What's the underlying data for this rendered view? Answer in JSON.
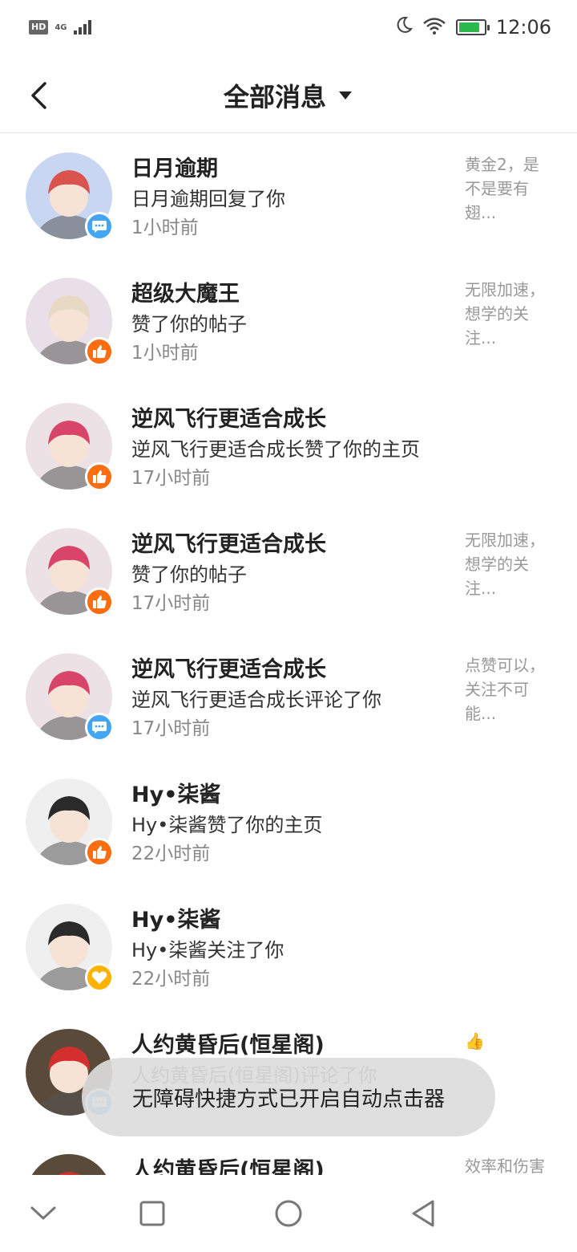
{
  "status_bar": {
    "hd": "HD",
    "network": "4G",
    "time": "12:06",
    "battery_level": 0.85
  },
  "header": {
    "title": "全部消息"
  },
  "messages": [
    {
      "name": "日月逾期",
      "action": "日月逾期回复了你",
      "time": "1小时前",
      "preview": "黄金2，是不是要有翅...",
      "badge": "comment",
      "avatar_color": "#c9d6f2",
      "hair": "#d9534f"
    },
    {
      "name": "超级大魔王",
      "action": "赞了你的帖子",
      "time": "1小时前",
      "preview": "无限加速，想学的关注...",
      "badge": "like",
      "avatar_color": "#e9dfe8",
      "hair": "#e8d9c4"
    },
    {
      "name": "逆风飞行更适合成长",
      "action": "逆风飞行更适合成长赞了你的主页",
      "time": "17小时前",
      "preview": "",
      "badge": "like",
      "avatar_color": "#ece2e6",
      "hair": "#d9456a"
    },
    {
      "name": "逆风飞行更适合成长",
      "action": "赞了你的帖子",
      "time": "17小时前",
      "preview": "无限加速，想学的关注...",
      "badge": "like",
      "avatar_color": "#ece2e6",
      "hair": "#d9456a"
    },
    {
      "name": "逆风飞行更适合成长",
      "action": "逆风飞行更适合成长评论了你",
      "time": "17小时前",
      "preview": "点赞可以，关注不可能...",
      "badge": "comment",
      "avatar_color": "#ece2e6",
      "hair": "#d9456a"
    },
    {
      "name": "Hy•柒酱",
      "action": "Hy•柒酱赞了你的主页",
      "time": "22小时前",
      "preview": "",
      "badge": "like",
      "avatar_color": "#efefef",
      "hair": "#2a2a2a"
    },
    {
      "name": "Hy•柒酱",
      "action": "Hy•柒酱关注了你",
      "time": "22小时前",
      "preview": "",
      "badge": "follow",
      "avatar_color": "#efefef",
      "hair": "#2a2a2a"
    },
    {
      "name": "人约黄昏后(恒星阁)",
      "action": "人约黄昏后(恒星阁)评论了你",
      "time": "",
      "preview": "👍",
      "badge": "comment",
      "avatar_color": "#5a4a3a",
      "hair": "#d32f2f"
    },
    {
      "name": "人约黄昏后(恒星阁)",
      "action": "",
      "time": "",
      "preview": "效率和伤害",
      "badge": "",
      "avatar_color": "#5a4a3a",
      "hair": "#d32f2f"
    }
  ],
  "toast": {
    "text": "无障碍快捷方式已开启自动点击器"
  },
  "nav": {
    "icons": [
      "chevron-down-icon",
      "recent-apps-icon",
      "home-icon",
      "back-triangle-icon"
    ]
  }
}
